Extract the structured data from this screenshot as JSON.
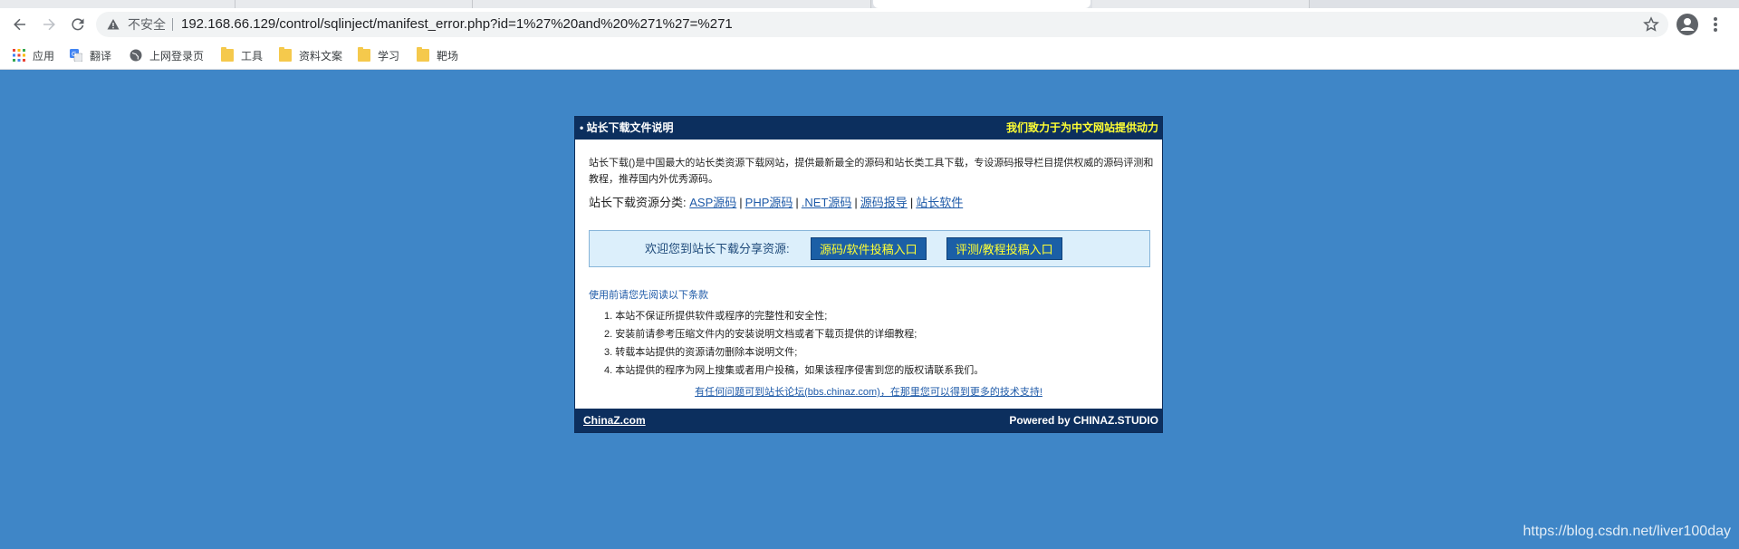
{
  "browser": {
    "security_label": "不安全",
    "url": "192.168.66.129/control/sqlinject/manifest_error.php?id=1%27%20and%20%271%27=%271",
    "icons": [
      "back-arrow-icon",
      "forward-arrow-icon",
      "reload-icon",
      "warning-icon",
      "star-icon",
      "profile-icon",
      "menu-dots-icon"
    ]
  },
  "bookmarks": [
    {
      "label": "应用",
      "icon": "apps-grid-icon"
    },
    {
      "label": "翻译",
      "icon": "translate-icon"
    },
    {
      "label": "上网登录页",
      "icon": "globe-icon"
    },
    {
      "label": "工具",
      "icon": "folder-icon"
    },
    {
      "label": "资料文案",
      "icon": "folder-icon"
    },
    {
      "label": "学习",
      "icon": "folder-icon"
    },
    {
      "label": "靶场",
      "icon": "folder-icon"
    }
  ],
  "card": {
    "header_left": "• 站长下载文件说明",
    "header_right": "我们致力于为中文网站提供动力",
    "intro": "站长下载()是中国最大的站长类资源下载网站，提供最新最全的源码和站长类工具下载，专设源码报导栏目提供权威的源码评测和教程，推荐国内外优秀源码。",
    "categories_label": "站长下载资源分类:",
    "categories": [
      "ASP源码",
      "PHP源码",
      ".NET源码",
      "源码报导",
      "站长软件"
    ],
    "share_text": "欢迎您到站长下载分享资源:",
    "share_buttons": [
      "源码/软件投稿入口",
      "评测/教程投稿入口"
    ],
    "notice_title": "使用前请您先阅读以下条款",
    "rules": [
      "1. 本站不保证所提供软件或程序的完整性和安全性;",
      "2. 安装前请参考压缩文件内的安装说明文档或者下载页提供的详细教程;",
      "3. 转载本站提供的资源请勿删除本说明文件;",
      "4. 本站提供的程序为网上搜集或者用户投稿，如果该程序侵害到您的版权请联系我们。"
    ],
    "forum_link": "有任何问题可到站长论坛(bbs.chinaz.com)，在那里您可以得到更多的技术支持!",
    "footer_left": "ChinaZ.com",
    "footer_right": "Powered by CHINAZ.STUDIO"
  },
  "watermark": "https://blog.csdn.net/liver100day",
  "colors": {
    "page_background": "#3f86c7",
    "card_header": "#0c2f5e",
    "accent_yellow": "#ffff33",
    "link_blue": "#1e5aa8",
    "share_box": "#dceffb"
  }
}
